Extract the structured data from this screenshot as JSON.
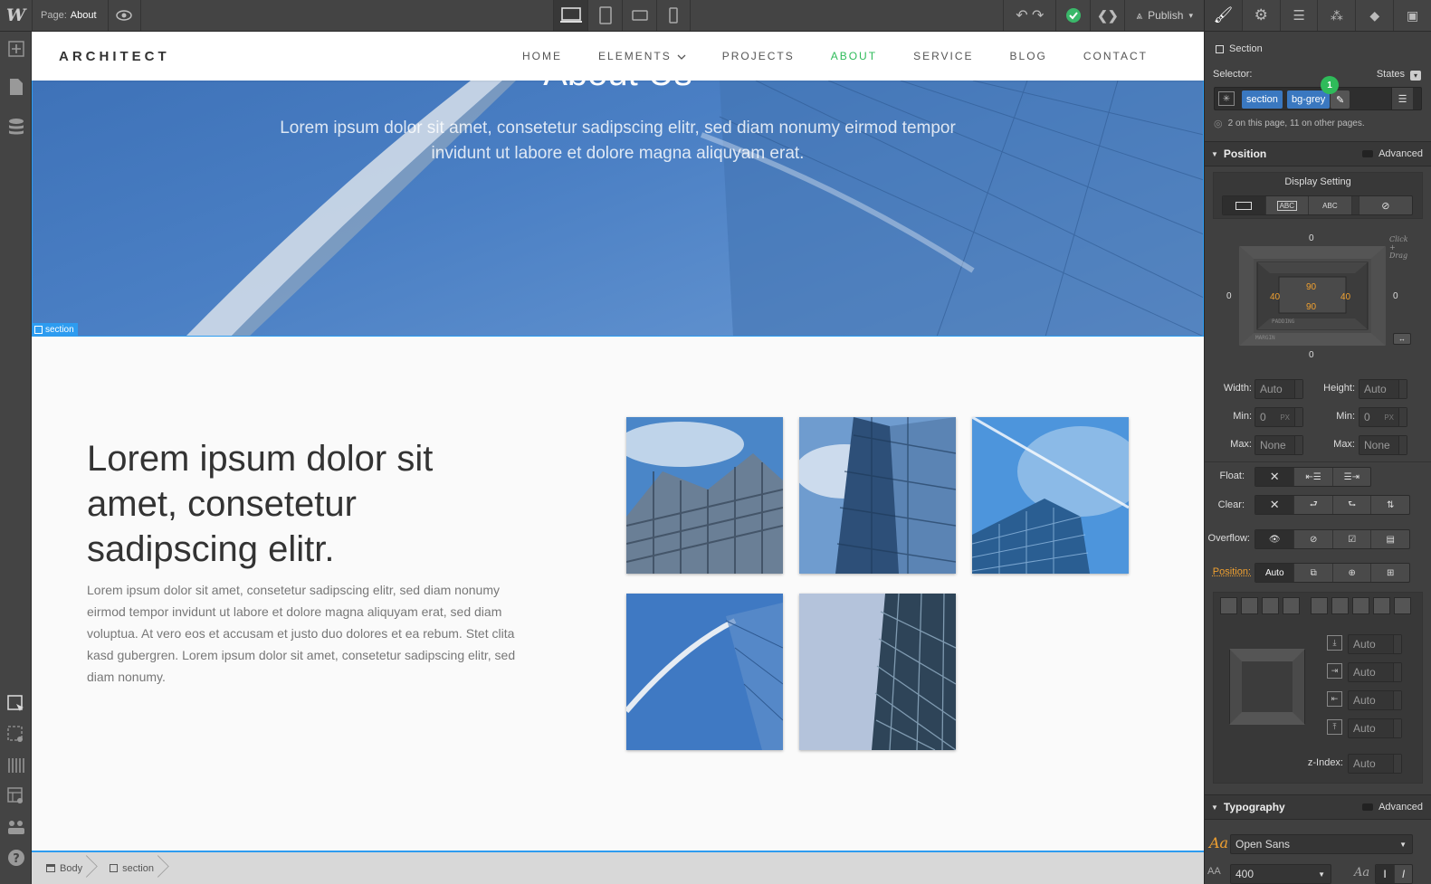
{
  "topbar": {
    "logo": "W",
    "page_label": "Page:",
    "page_name": "About",
    "publish_label": "Publish"
  },
  "site": {
    "brand": "ARCHITECT",
    "menu": [
      {
        "label": "HOME"
      },
      {
        "label": "ELEMENTS"
      },
      {
        "label": "PROJECTS"
      },
      {
        "label": "ABOUT"
      },
      {
        "label": "SERVICE"
      },
      {
        "label": "BLOG"
      },
      {
        "label": "CONTACT"
      }
    ],
    "active_menu": "ABOUT",
    "accent_color": "#2fbb5a",
    "hero_title": "About Us",
    "hero_subtitle": "Lorem ipsum dolor sit amet, consetetur sadipscing elitr, sed diam nonumy eirmod tempor invidunt ut labore et dolore magna aliquyam erat.",
    "heading": "Lorem ipsum dolor sit amet, consetetur sadipscing elitr.",
    "paragraph": "Lorem ipsum dolor sit amet, consetetur sadipscing elitr, sed diam nonumy eirmod tempor invidunt ut labore et dolore magna aliquyam erat, sed diam voluptua. At vero eos et accusam et justo duo dolores et ea rebum. Stet clita kasd gubergren. Lorem ipsum dolor sit amet, consetetur sadipscing elitr, sed diam nonumy."
  },
  "canvas": {
    "selection_label": "section",
    "selection_color": "#2d9cf0"
  },
  "breadcrumb": [
    "Body",
    "section"
  ],
  "panel": {
    "element_name": "Section",
    "selector_label": "Selector:",
    "states_label": "States",
    "chips": [
      "section",
      "bg-grey"
    ],
    "badge": "1",
    "usage_note": "2 on this page, 11 on other pages.",
    "position_title": "Position",
    "advanced_label": "Advanced",
    "display_setting_label": "Display Setting",
    "display_opts": [
      "ABC",
      "ABC"
    ],
    "click_drag": "Click + Drag",
    "margin": {
      "top": "0",
      "right": "0",
      "bottom": "0",
      "left": "0"
    },
    "padding": {
      "top": "90",
      "right": "40",
      "bottom": "90",
      "left": "40"
    },
    "padding_label": "PADDING",
    "margin_label": "MARGIN",
    "width_label": "Width:",
    "height_label": "Height:",
    "min_label": "Min:",
    "max_label": "Max:",
    "width_value": "Auto",
    "height_value": "Auto",
    "min_w": "0",
    "min_h": "0",
    "max_w": "None",
    "max_h": "None",
    "px": "PX",
    "float_label": "Float:",
    "clear_label": "Clear:",
    "overflow_label": "Overflow:",
    "position_label": "Position:",
    "position_value": "Auto",
    "pos_fields": [
      "Auto",
      "Auto",
      "Auto",
      "Auto"
    ],
    "zindex_label": "z-Index:",
    "zindex_value": "Auto",
    "typography_title": "Typography",
    "font_name": "Open Sans",
    "font_weight": "400",
    "font_icon": "Aa"
  }
}
